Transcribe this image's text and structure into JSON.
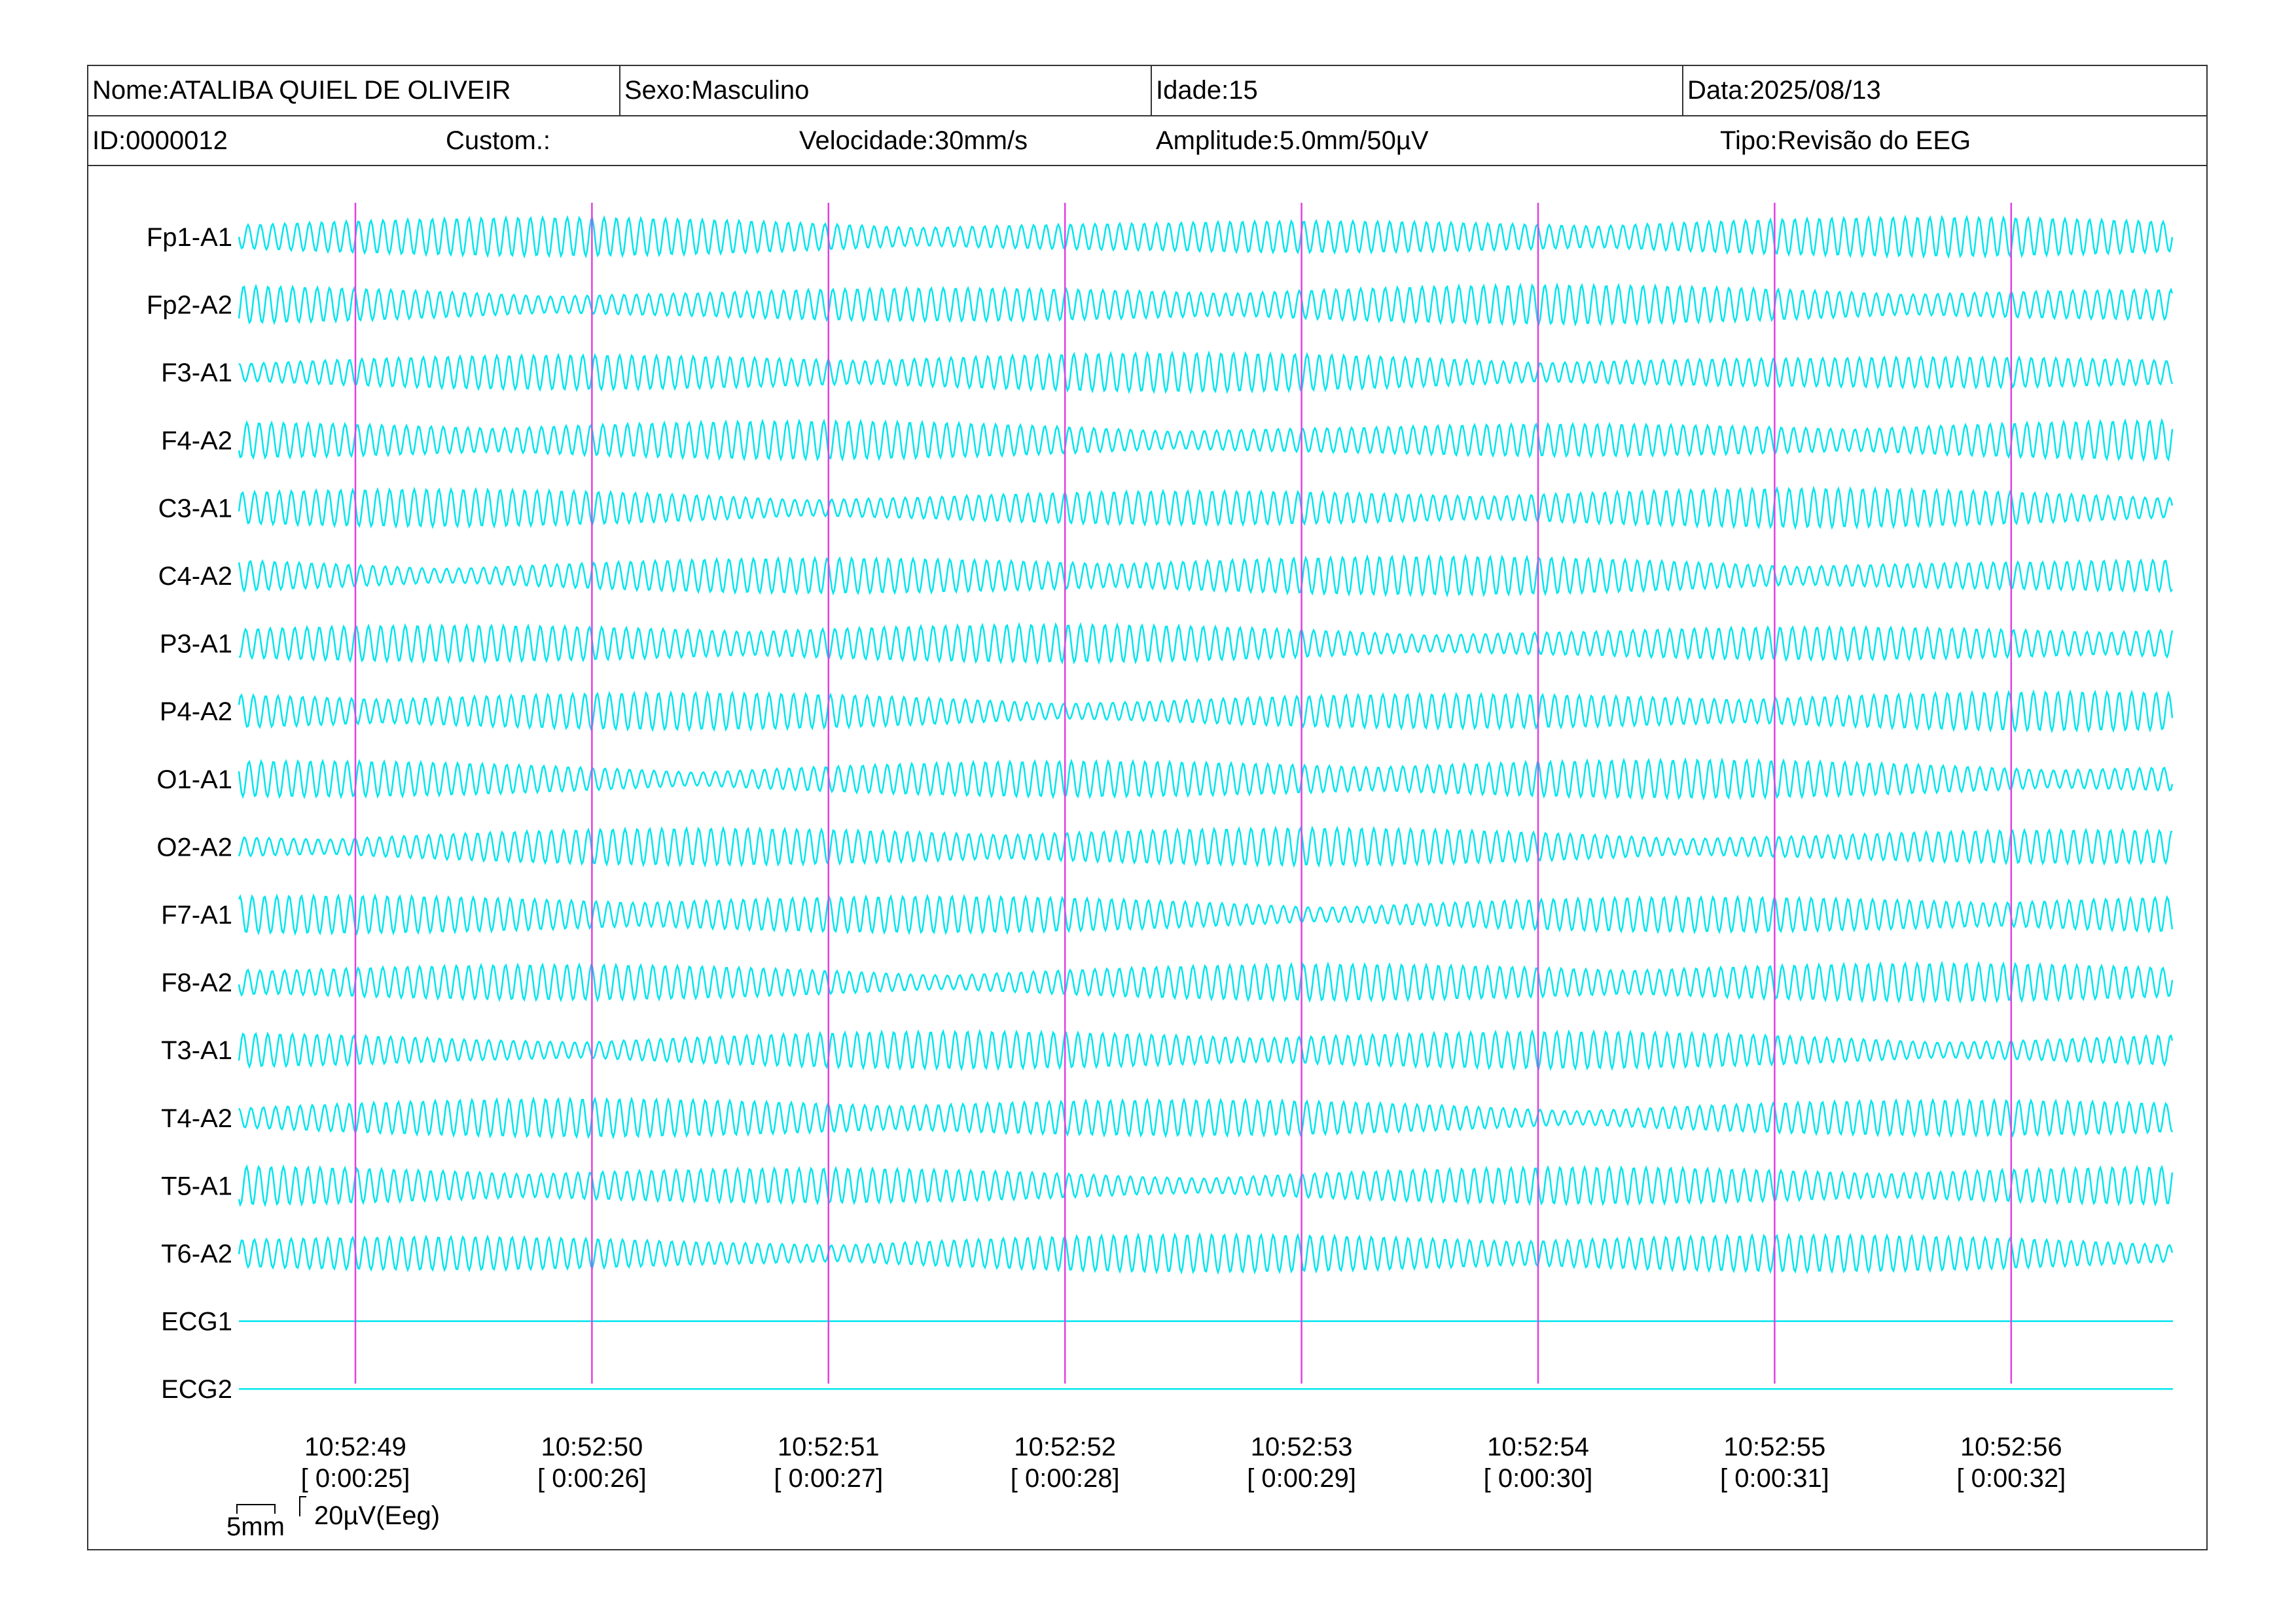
{
  "header": {
    "name": "Nome:ATALIBA QUIEL DE OLIVEIR",
    "sex": "Sexo:Masculino",
    "age": "Idade:15",
    "date": "Data:2025/08/13",
    "id": "ID:0000012",
    "custom": "Custom.:",
    "speed": "Velocidade:30mm/s",
    "amplitude": "Amplitude:5.0mm/50µV",
    "type": "Tipo:Revisão do EEG"
  },
  "colors": {
    "trace": "#00e5ee",
    "marker": "#e040e0",
    "border": "#333333"
  },
  "chart_data": {
    "type": "line",
    "title": "",
    "xlabel": "",
    "ylabel": "",
    "channels": [
      "Fp1-A1",
      "Fp2-A2",
      "F3-A1",
      "F4-A2",
      "C3-A1",
      "C4-A2",
      "P3-A1",
      "P4-A2",
      "O1-A1",
      "O2-A2",
      "F7-A1",
      "F8-A2",
      "T3-A1",
      "T4-A2",
      "T5-A1",
      "T6-A2",
      "ECG1",
      "ECG2"
    ],
    "flat_channels": [
      "ECG1",
      "ECG2"
    ],
    "time_markers": [
      {
        "clock": "10:52:49",
        "elapsed": "[ 0:00:25]"
      },
      {
        "clock": "10:52:50",
        "elapsed": "[ 0:00:26]"
      },
      {
        "clock": "10:52:51",
        "elapsed": "[ 0:00:27]"
      },
      {
        "clock": "10:52:52",
        "elapsed": "[ 0:00:28]"
      },
      {
        "clock": "10:52:53",
        "elapsed": "[ 0:00:29]"
      },
      {
        "clock": "10:52:54",
        "elapsed": "[ 0:00:30]"
      },
      {
        "clock": "10:52:55",
        "elapsed": "[ 0:00:31]"
      },
      {
        "clock": "10:52:56",
        "elapsed": "[ 0:00:32]"
      }
    ],
    "scale": {
      "time": "5mm",
      "amplitude": "20µV(Eeg)"
    },
    "grid": false
  }
}
